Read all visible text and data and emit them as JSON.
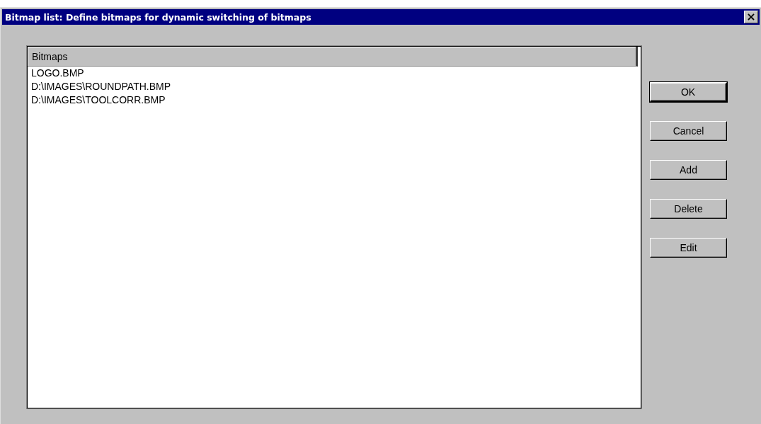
{
  "window": {
    "title": "Bitmap list: Define bitmaps for dynamic switching of bitmaps",
    "close": "×"
  },
  "list": {
    "column": "Bitmaps",
    "rows": [
      {
        "text": "LOGO.BMP"
      },
      {
        "text": "D:\\IMAGES\\ROUNDPATH.BMP"
      },
      {
        "text": "D:\\IMAGES\\TOOLCORR.BMP"
      }
    ]
  },
  "buttons": [
    {
      "label": "OK",
      "default": true
    },
    {
      "label": "Cancel",
      "default": false
    },
    {
      "label": "Add",
      "default": false
    },
    {
      "label": "Delete",
      "default": false
    },
    {
      "label": "Edit",
      "default": false
    }
  ]
}
